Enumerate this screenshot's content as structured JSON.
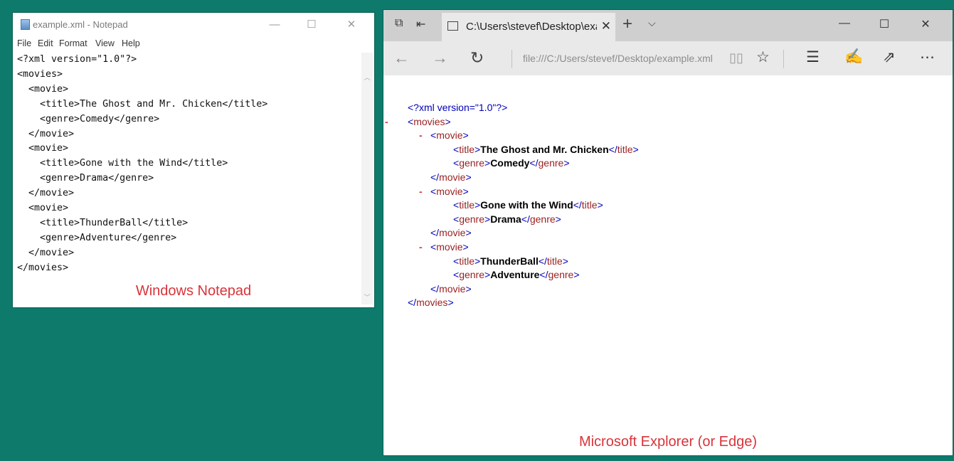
{
  "notepad": {
    "title": "example.xml - Notepad",
    "controls": {
      "minimize": "—",
      "maximize": "☐",
      "close": "✕"
    },
    "menu": [
      "File",
      "Edit",
      "Format",
      "View",
      "Help"
    ],
    "lines": [
      "<?xml version=\"1.0\"?>",
      "<movies>",
      "  <movie>",
      "    <title>The Ghost and Mr. Chicken</title>",
      "    <genre>Comedy</genre>",
      "  </movie>",
      "  <movie>",
      "    <title>Gone with the Wind</title>",
      "    <genre>Drama</genre>",
      "  </movie>",
      "  <movie>",
      "    <title>ThunderBall</title>",
      "    <genre>Adventure</genre>",
      "  </movie>",
      "</movies>"
    ],
    "caption": "Windows Notepad"
  },
  "browser": {
    "tab": {
      "title": "C:\\Users\\stevef\\Desktop\\example.xml",
      "close": "✕"
    },
    "new_tab": "+",
    "tab_menu": "⌵",
    "window_controls": {
      "minimize": "—",
      "maximize": "☐",
      "close": "✕"
    },
    "address": "file:///C:/Users/stevef/Desktop/example.xml",
    "xml": {
      "declaration": "<?xml version=\"1.0\"?>",
      "root": "movies",
      "movies": [
        {
          "title": "The Ghost and Mr. Chicken",
          "genre": "Comedy"
        },
        {
          "title": "Gone with the Wind",
          "genre": "Drama"
        },
        {
          "title": "ThunderBall",
          "genre": "Adventure"
        }
      ]
    },
    "caption": "Microsoft Explorer (or Edge)"
  },
  "colors": {
    "desktop": "#0d7a6c",
    "xml_bracket": "#0000b5",
    "xml_tag_name": "#9a1f1f",
    "collapse_marker": "#d23a3a",
    "caption": "#d9343a"
  }
}
